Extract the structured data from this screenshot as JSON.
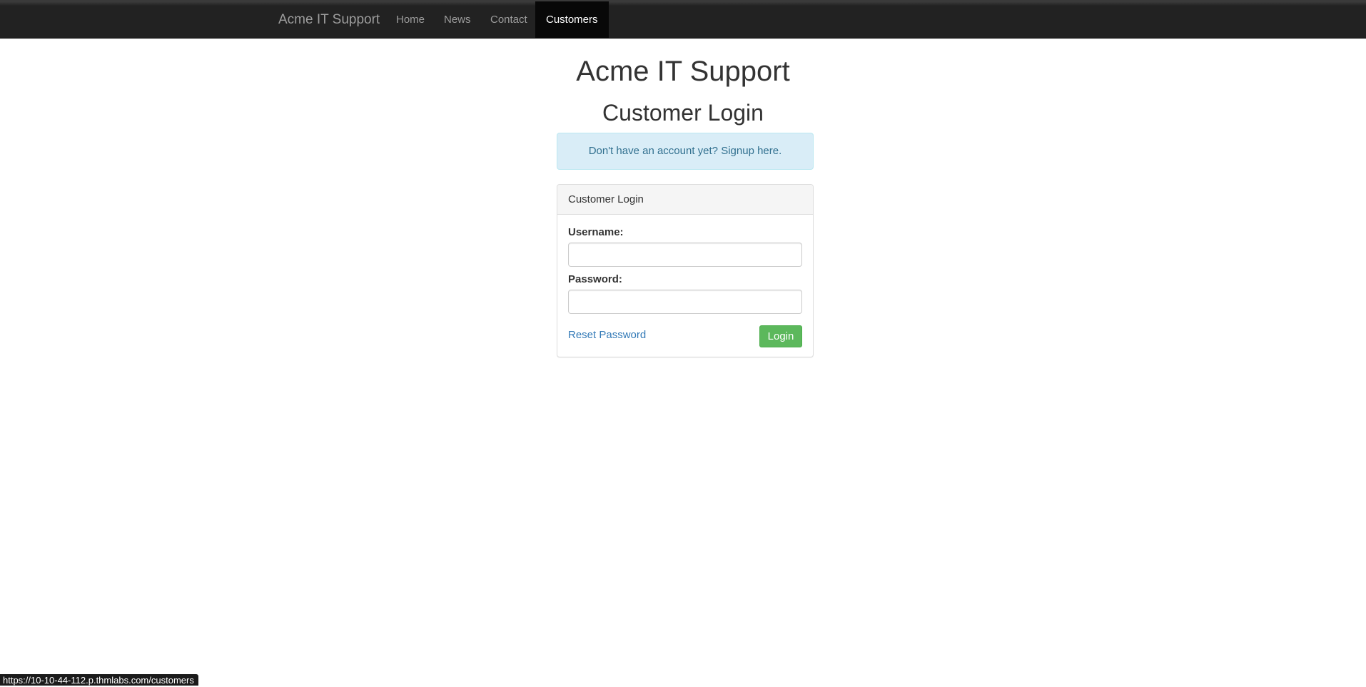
{
  "navbar": {
    "brand": "Acme IT Support",
    "items": [
      {
        "label": "Home",
        "active": false
      },
      {
        "label": "News",
        "active": false
      },
      {
        "label": "Contact",
        "active": false
      },
      {
        "label": "Customers",
        "active": true
      }
    ]
  },
  "header": {
    "site_title": "Acme IT Support",
    "page_title": "Customer Login"
  },
  "signup_alert": {
    "text": "Don't have an account yet?",
    "link_label": "Signup here."
  },
  "login_panel": {
    "heading": "Customer Login",
    "username_label": "Username:",
    "username_value": "",
    "password_label": "Password:",
    "password_value": "",
    "reset_link": "Reset Password",
    "login_button": "Login"
  },
  "status_bar": {
    "url": "https://10-10-44-112.p.thmlabs.com/customers"
  },
  "colors": {
    "navbar_bg": "#222222",
    "active_nav_bg": "#080808",
    "alert_bg": "#d9edf7",
    "alert_text": "#31708f",
    "link": "#337ab7",
    "button_success": "#5cb85c"
  }
}
